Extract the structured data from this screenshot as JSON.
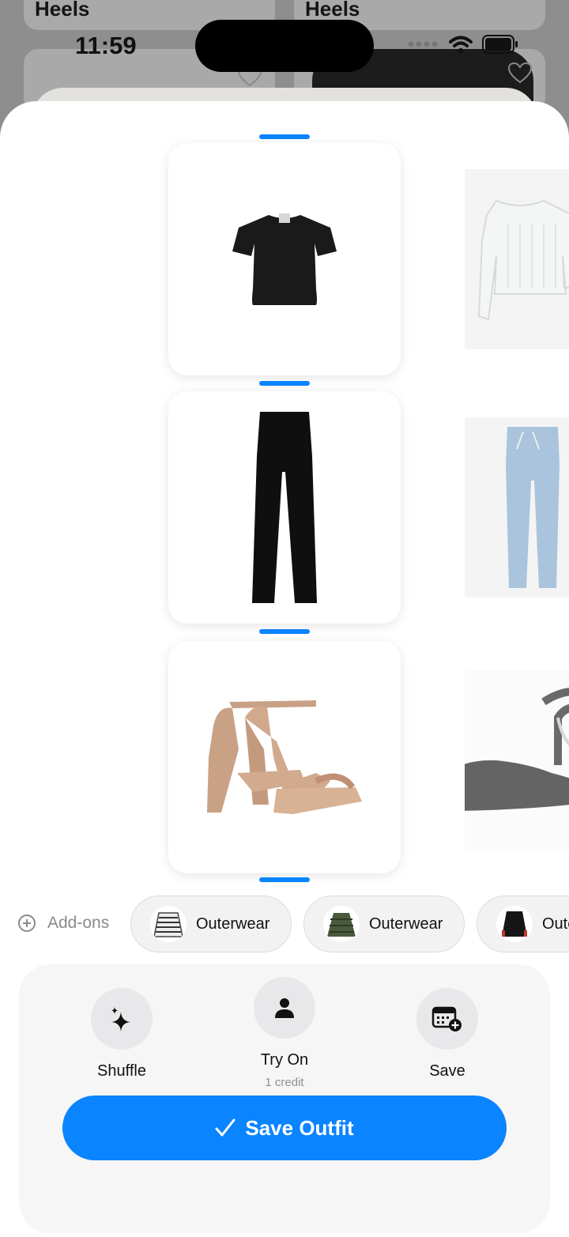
{
  "background": {
    "time": "11:59",
    "card_labels": [
      "Heels",
      "Heels"
    ]
  },
  "addons": {
    "label": "Add-ons",
    "chips": [
      {
        "label": "Outerwear",
        "icon": "striped-jacket-thumbnail"
      },
      {
        "label": "Outerwear",
        "icon": "green-puffer-thumbnail"
      },
      {
        "label": "Oute",
        "icon": "black-jacket-thumbnail"
      }
    ]
  },
  "actions": {
    "shuffle": {
      "label": "Shuffle",
      "icon": "sparkle-icon"
    },
    "try_on": {
      "label": "Try On",
      "sub": "1 credit",
      "icon": "person-icon"
    },
    "save": {
      "label": "Save",
      "icon": "calendar-add-icon"
    }
  },
  "primary_button": {
    "label": "Save Outfit",
    "icon": "checkmark-icon"
  },
  "colors": {
    "accent": "#0a84ff",
    "panel": "#f6f6f6"
  }
}
